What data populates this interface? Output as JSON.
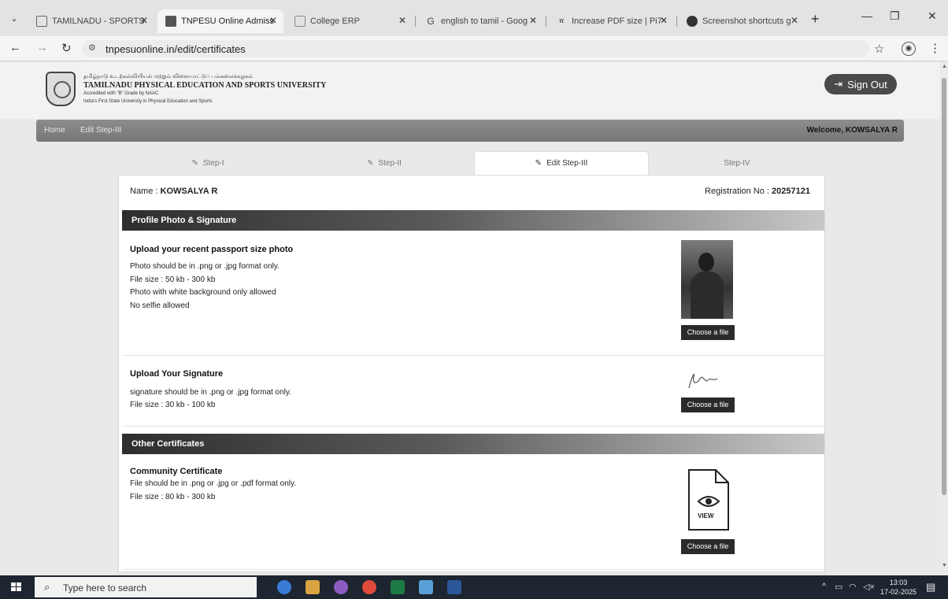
{
  "browser": {
    "tabs": [
      {
        "title": "TAMILNADU - SPORTS",
        "active": false
      },
      {
        "title": "TNPESU Online Admiss",
        "active": true
      },
      {
        "title": "College ERP",
        "active": false
      },
      {
        "title": "english to tamil - Goog",
        "active": false
      },
      {
        "title": "Increase PDF size | Pi7",
        "active": false
      },
      {
        "title": "Screenshot shortcuts g",
        "active": false
      }
    ],
    "url": "tnpesuonline.in/edit/certificates"
  },
  "header": {
    "tamil_name": "தமிழ்நாடு உடற்கல்வியியல் மற்றும் விளையாட்டுப் பல்கலைக்கழகம்",
    "university_name": "TAMILNADU PHYSICAL EDUCATION AND SPORTS UNIVERSITY",
    "accreditation": "Accredited with \"B\" Grade by NAAC",
    "tagline": "India's First State University in Physical Education and Sports",
    "sign_out": "Sign Out"
  },
  "breadcrumb": {
    "home": "Home",
    "current": "Edit Step-III",
    "welcome": "Welcome, KOWSALYA R"
  },
  "steps": [
    {
      "label": "Step-I"
    },
    {
      "label": "Step-II"
    },
    {
      "label": "Edit Step-III"
    },
    {
      "label": "Step-IV"
    }
  ],
  "applicant": {
    "name_label": "Name :",
    "name": "KOWSALYA R",
    "reg_label": "Registration No :",
    "reg_no": "20257121"
  },
  "sections": {
    "profile": "Profile Photo & Signature",
    "other": "Other Certificates"
  },
  "photo_block": {
    "title": "Upload your recent passport size photo",
    "lines": [
      "Photo should be in .png or .jpg format only.",
      "File size : 50 kb - 300 kb",
      "Photo with white background only allowed",
      "No selfie allowed"
    ],
    "button": "Choose a file"
  },
  "signature_block": {
    "title": "Upload Your Signature",
    "lines": [
      "signature should be in .png or .jpg format only.",
      "File size : 30 kb - 100 kb"
    ],
    "button": "Choose a file"
  },
  "community_block": {
    "title": "Community Certificate",
    "lines": [
      "File should be in .png or .jpg or .pdf format only.",
      "File size : 80 kb - 300 kb"
    ],
    "view_label": "VIEW",
    "button": "Choose a file"
  },
  "taskbar": {
    "search_placeholder": "Type here to search",
    "time": "13:03",
    "date": "17-02-2025"
  }
}
